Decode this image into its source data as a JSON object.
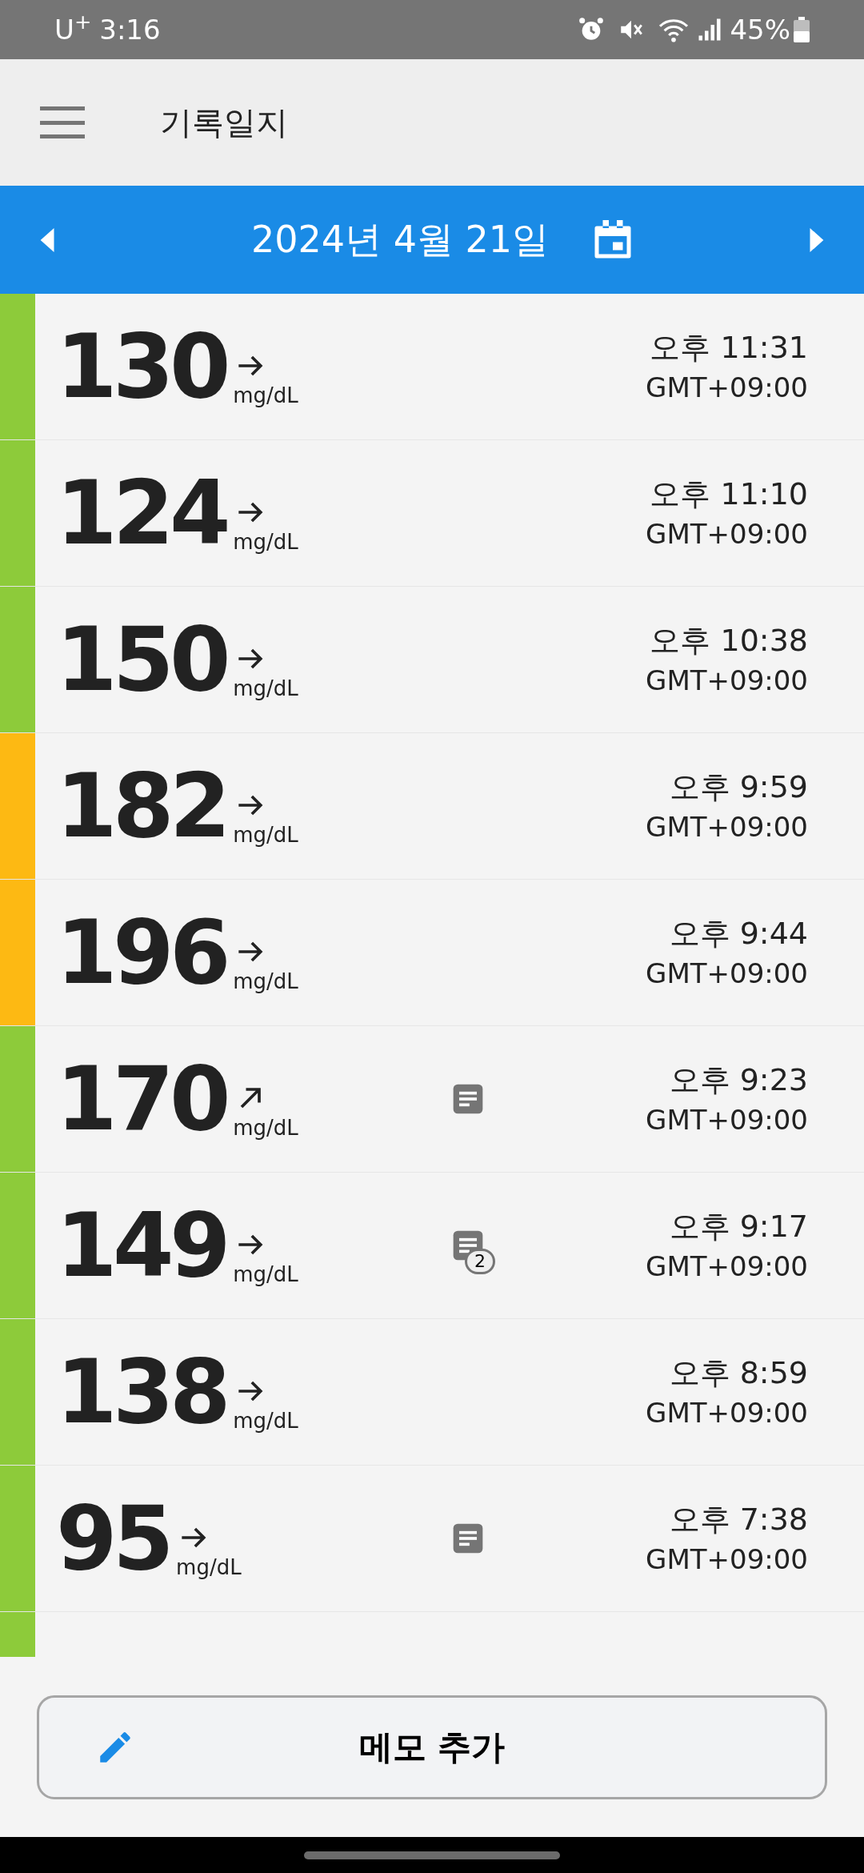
{
  "status_bar": {
    "carrier": "U$^{+}$",
    "time": "3:16",
    "battery": "45%"
  },
  "app_bar": {
    "title": "기록일지"
  },
  "date_bar": {
    "date": "2024년 4월 21일"
  },
  "readings": [
    {
      "value": "130",
      "rising": false,
      "unit": "mg/dL",
      "time": "오후 11:31",
      "zone": "GMT+09:00",
      "color": "#8dcb3a",
      "memo": false
    },
    {
      "value": "124",
      "rising": false,
      "unit": "mg/dL",
      "time": "오후 11:10",
      "zone": "GMT+09:00",
      "color": "#8dcb3a",
      "memo": false
    },
    {
      "value": "150",
      "rising": false,
      "unit": "mg/dL",
      "time": "오후 10:38",
      "zone": "GMT+09:00",
      "color": "#8dcb3a",
      "memo": false
    },
    {
      "value": "182",
      "rising": false,
      "unit": "mg/dL",
      "time": "오후 9:59",
      "zone": "GMT+09:00",
      "color": "#fdb913",
      "memo": false
    },
    {
      "value": "196",
      "rising": false,
      "unit": "mg/dL",
      "time": "오후 9:44",
      "zone": "GMT+09:00",
      "color": "#fdb913",
      "memo": false
    },
    {
      "value": "170",
      "rising": true,
      "unit": "mg/dL",
      "time": "오후 9:23",
      "zone": "GMT+09:00",
      "color": "#8dcb3a",
      "memo": true
    },
    {
      "value": "149",
      "rising": false,
      "unit": "mg/dL",
      "time": "오후 9:17",
      "zone": "GMT+09:00",
      "color": "#8dcb3a",
      "memo": true,
      "memo_count": "2"
    },
    {
      "value": "138",
      "rising": false,
      "unit": "mg/dL",
      "time": "오후 8:59",
      "zone": "GMT+09:00",
      "color": "#8dcb3a",
      "memo": false
    },
    {
      "value": "95",
      "rising": false,
      "unit": "mg/dL",
      "time": "오후 7:38",
      "zone": "GMT+09:00",
      "color": "#8dcb3a",
      "memo": true
    }
  ],
  "partial_row": {
    "color": "#8dcb3a"
  },
  "add_memo_button": {
    "label": "메모 추가"
  }
}
